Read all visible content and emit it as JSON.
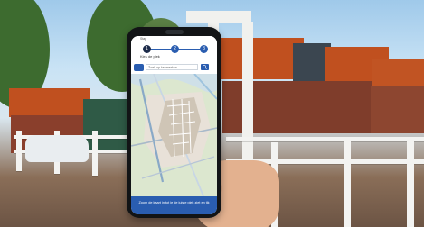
{
  "app": {
    "steps": {
      "step_caption": "Stap",
      "items": [
        "1",
        "2",
        "3"
      ],
      "current_step_title": "Kies de plek"
    },
    "search": {
      "placeholder": "Zoek op kenmerken"
    },
    "map": {
      "visible": true
    },
    "cta": {
      "text": "Zoom de kaart in tot je de juiste plek ziet en tik"
    },
    "colors": {
      "accent": "#2a5db0",
      "dark": "#1d2b4a"
    },
    "icons": {
      "search": "search-icon",
      "logo": "app-logo"
    }
  }
}
